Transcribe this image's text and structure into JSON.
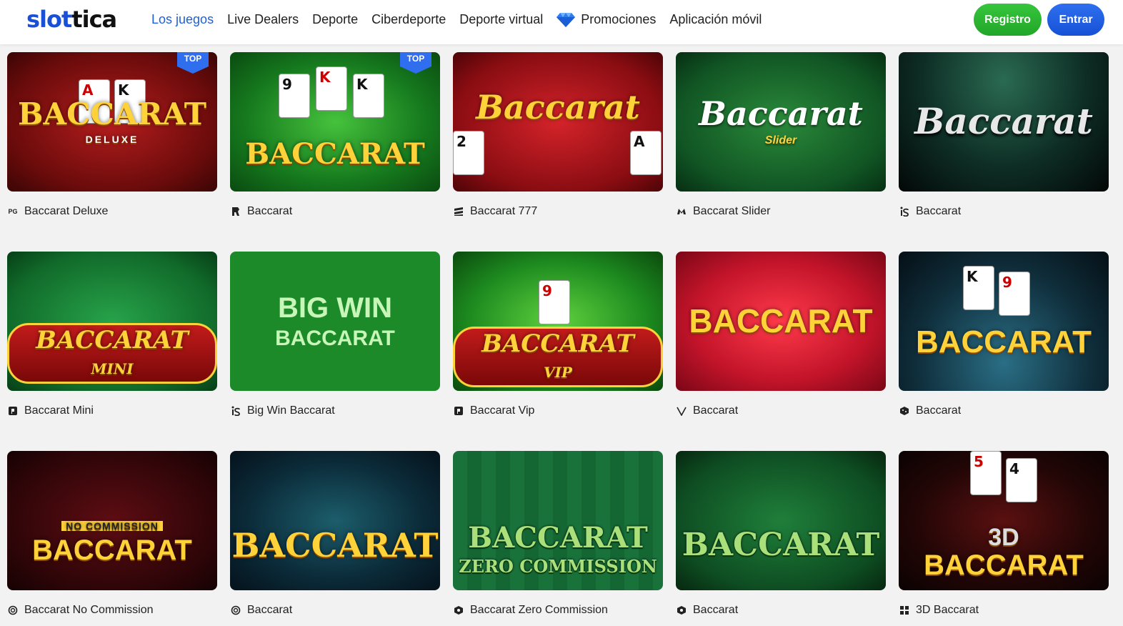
{
  "header": {
    "logo": "slottica",
    "nav": [
      {
        "label": "Los juegos",
        "active": true
      },
      {
        "label": "Live Dealers"
      },
      {
        "label": "Deporte"
      },
      {
        "label": "Ciberdeporte"
      },
      {
        "label": "Deporte virtual"
      },
      {
        "label": "Promociones",
        "icon": "diamond-icon"
      },
      {
        "label": "Aplicación móvil"
      }
    ],
    "register_label": "Registro",
    "login_label": "Entrar"
  },
  "badge_label": "TOP",
  "games": [
    {
      "name": "Baccarat Deluxe",
      "provider_icon": "pg-logo-icon",
      "provider_text": "PG",
      "thumb_title": "BACCARAT",
      "thumb_sub": "DELUXE",
      "top": true
    },
    {
      "name": "Baccarat",
      "provider_icon": "r-logo-icon",
      "thumb_title": "BACCARAT",
      "top": true
    },
    {
      "name": "Baccarat 777",
      "provider_icon": "stripes-logo-icon",
      "thumb_title": "Baccarat"
    },
    {
      "name": "Baccarat Slider",
      "provider_icon": "m-logo-icon",
      "thumb_title": "Baccarat",
      "thumb_sub": "Slider"
    },
    {
      "name": "Baccarat",
      "provider_icon": "is-logo-icon",
      "thumb_title": "Baccarat"
    },
    {
      "name": "Baccarat Mini",
      "provider_icon": "p-logo-icon",
      "thumb_title": "BACCARAT",
      "thumb_sub": "MINI"
    },
    {
      "name": "Big Win Baccarat",
      "provider_icon": "is-logo-icon",
      "thumb_title": "BIG WIN",
      "thumb_sub": "BACCARAT"
    },
    {
      "name": "Baccarat Vip",
      "provider_icon": "p-logo-icon",
      "thumb_title": "BACCARAT",
      "thumb_sub": "VIP"
    },
    {
      "name": "Baccarat",
      "provider_icon": "v-logo-icon",
      "thumb_title": "BACCARAT"
    },
    {
      "name": "Baccarat",
      "provider_icon": "dice-logo-icon",
      "thumb_title": "BACCARAT"
    },
    {
      "name": "Baccarat No Commission",
      "provider_icon": "circle-logo-icon",
      "thumb_title": "BACCARAT",
      "thumb_sub": "NO COMMISSION"
    },
    {
      "name": "Baccarat",
      "provider_icon": "circle-logo-icon",
      "thumb_title": "BACCARAT"
    },
    {
      "name": "Baccarat Zero Commission",
      "provider_icon": "hex-logo-icon",
      "thumb_title": "BACCARAT",
      "thumb_sub": "ZERO COMMISSION"
    },
    {
      "name": "Baccarat",
      "provider_icon": "hex-logo-icon",
      "thumb_title": "BACCARAT"
    },
    {
      "name": "3D Baccarat",
      "provider_icon": "grid-logo-icon",
      "thumb_title": "BACCARAT",
      "thumb_sub": "3D"
    }
  ]
}
